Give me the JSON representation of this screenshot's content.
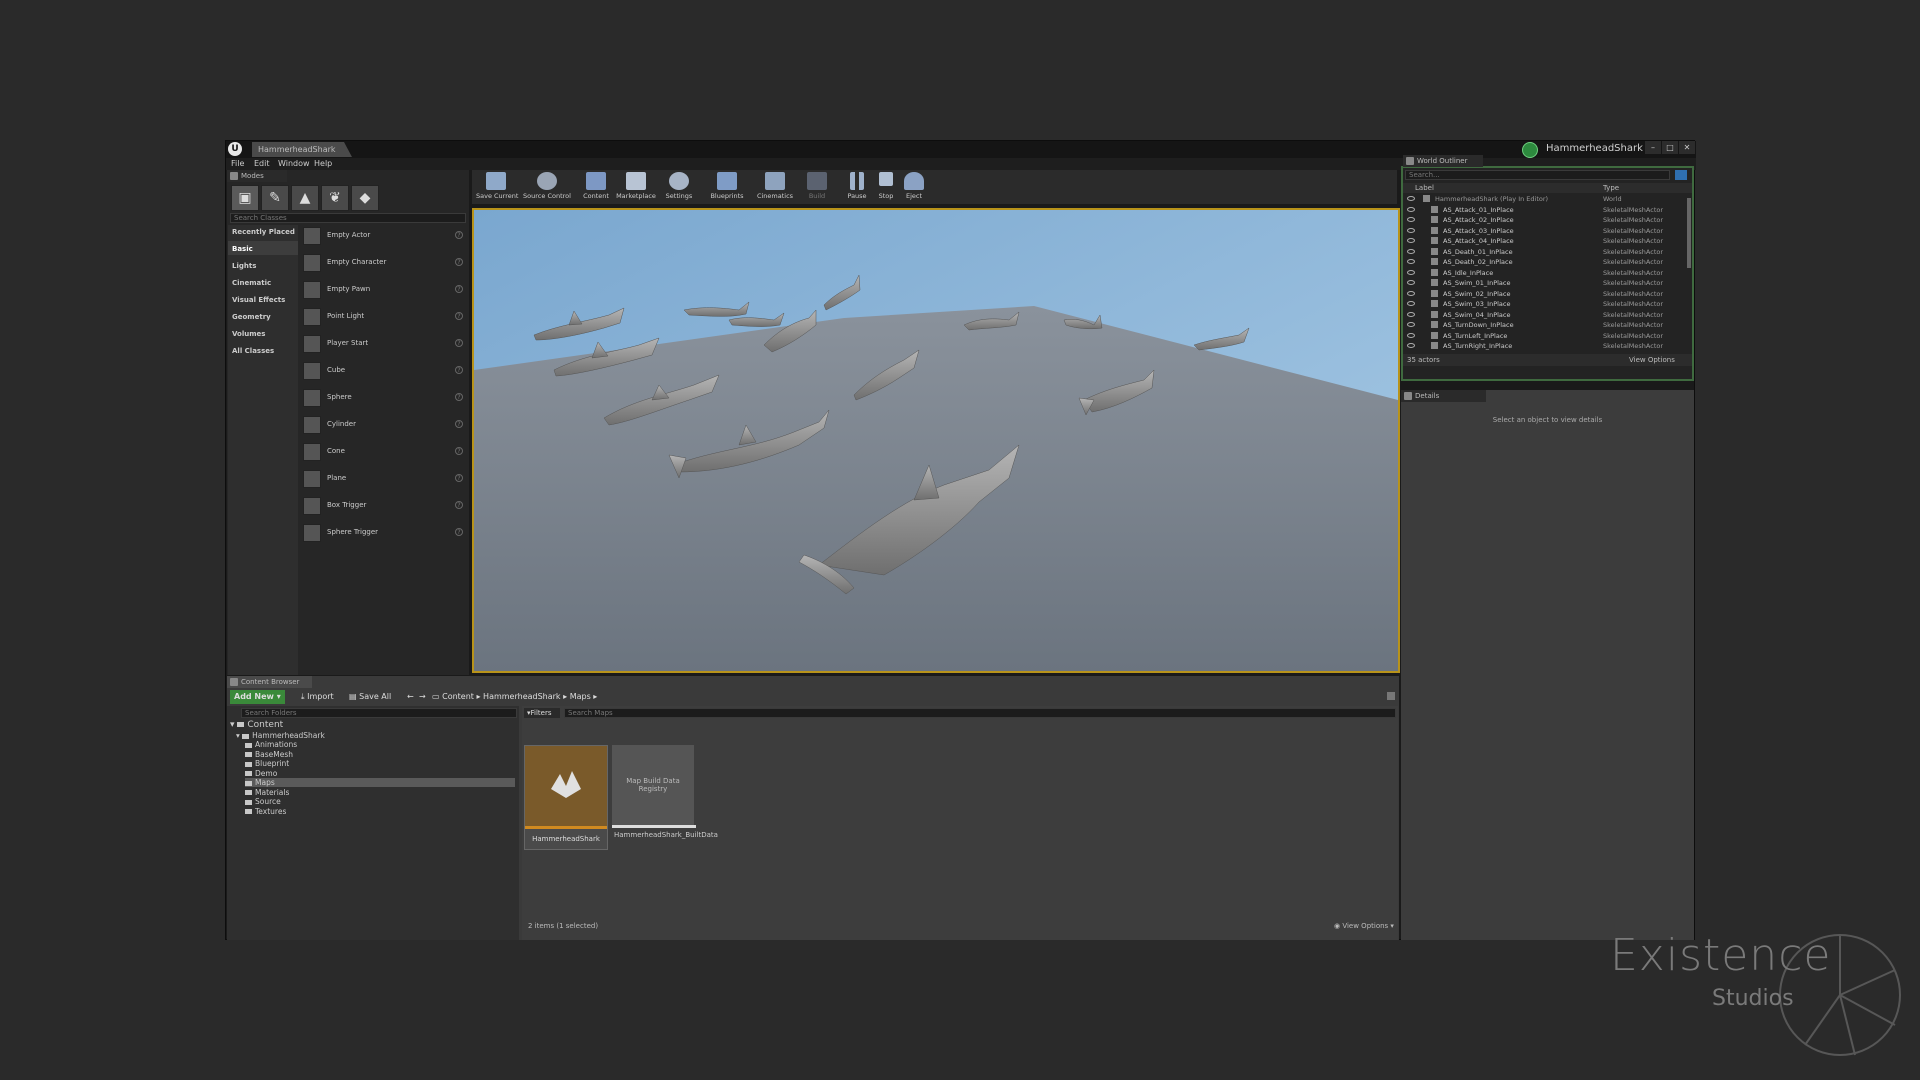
{
  "window": {
    "tab_title": "HammerheadShark",
    "project_name": "HammerheadShark",
    "buttons": [
      "–",
      "□",
      "✕"
    ]
  },
  "menu": [
    "File",
    "Edit",
    "Window",
    "Help"
  ],
  "modes": {
    "tab_label": "Modes",
    "search_placeholder": "Search Classes",
    "categories": [
      "Recently Placed",
      "Basic",
      "Lights",
      "Cinematic",
      "Visual Effects",
      "Geometry",
      "Volumes",
      "All Classes"
    ],
    "selected_category": "Basic",
    "items": [
      "Empty Actor",
      "Empty Character",
      "Empty Pawn",
      "Point Light",
      "Player Start",
      "Cube",
      "Sphere",
      "Cylinder",
      "Cone",
      "Plane",
      "Box Trigger",
      "Sphere Trigger"
    ]
  },
  "toolbar": {
    "buttons": [
      "Save Current",
      "Source Control",
      "Content",
      "Marketplace",
      "Settings",
      "Blueprints",
      "Cinematics",
      "Build",
      "Pause",
      "Stop",
      "Eject"
    ]
  },
  "outliner": {
    "tab_label": "World Outliner",
    "search_placeholder": "Search...",
    "col_label": "Label",
    "col_type": "Type",
    "root": {
      "label": "HammerheadShark (Play In Editor)",
      "type": "World"
    },
    "rows": [
      "AS_Attack_01_InPlace",
      "AS_Attack_02_InPlace",
      "AS_Attack_03_InPlace",
      "AS_Attack_04_InPlace",
      "AS_Death_01_InPlace",
      "AS_Death_02_InPlace",
      "AS_Idle_InPlace",
      "AS_Swim_01_InPlace",
      "AS_Swim_02_InPlace",
      "AS_Swim_03_InPlace",
      "AS_Swim_04_InPlace",
      "AS_TurnDown_InPlace",
      "AS_TurnLeft_InPlace",
      "AS_TurnRight_InPlace"
    ],
    "row_type": "SkeletalMeshActor",
    "actor_count": "35 actors",
    "view_options": "View Options"
  },
  "details": {
    "tab_label": "Details",
    "empty_msg": "Select an object to view details"
  },
  "content_browser": {
    "tab_label": "Content Browser",
    "add_new": "Add New",
    "import": "Import",
    "save_all": "Save All",
    "path": [
      "Content",
      "HammerheadShark",
      "Maps"
    ],
    "search_folders": "Search Folders",
    "filters": "Filters",
    "search_maps": "Search Maps",
    "tree": {
      "root": "Content",
      "project": "HammerheadShark",
      "folders": [
        "Animations",
        "BaseMesh",
        "Blueprint",
        "Demo",
        "Maps",
        "Materials",
        "Source",
        "Textures"
      ]
    },
    "assets": [
      {
        "name": "HammerheadShark",
        "thumb_text": ""
      },
      {
        "name": "HammerheadShark_BuiltData",
        "thumb_text": "Map Build Data Registry"
      }
    ],
    "status": "2 items (1 selected)",
    "view_options": "View Options"
  },
  "watermark": {
    "line1": "Existence",
    "line2": "Studios"
  },
  "colors": {
    "accent_green": "#2d8a3e",
    "viewport_border": "#b8931a",
    "sky": "#8ab3d6",
    "floor": "#6b747f"
  }
}
